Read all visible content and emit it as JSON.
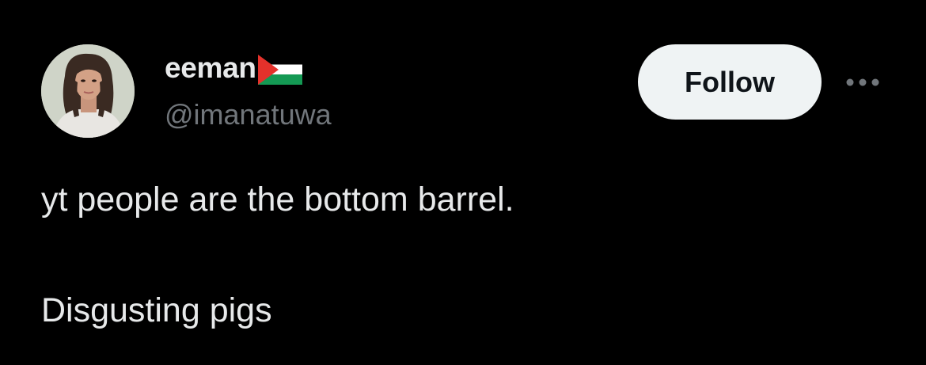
{
  "post": {
    "author": {
      "display_name": "eeman",
      "flag": "palestine-flag",
      "handle": "@imanatuwa",
      "avatar": "profile-photo"
    },
    "follow_label": "Follow",
    "more_icon": "more-horizontal-icon",
    "text_lines": [
      "yt people are the bottom barrel.",
      "Disgusting pigs"
    ]
  },
  "colors": {
    "background": "#000000",
    "primary_text": "#e7e9ea",
    "secondary_text": "#71767b",
    "follow_button_bg": "#eff3f4",
    "follow_button_text": "#0f1419"
  }
}
